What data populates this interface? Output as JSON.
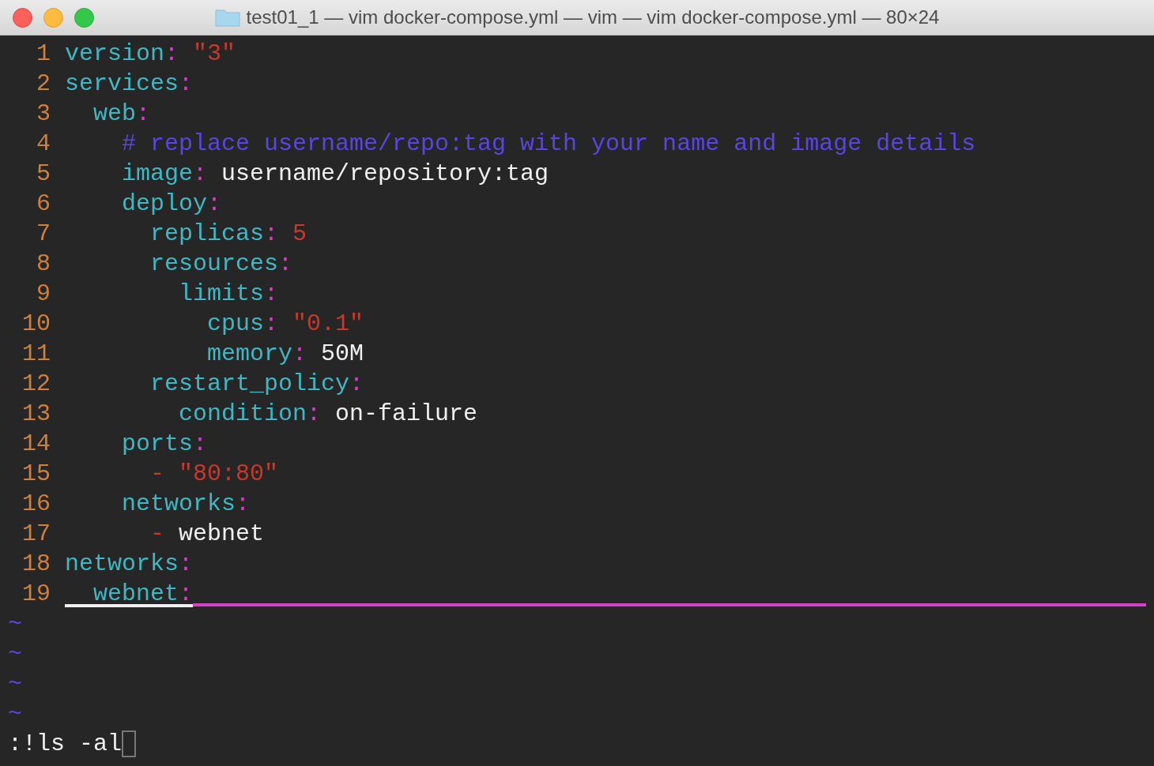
{
  "window": {
    "title": "test01_1 — vim docker-compose.yml — vim — vim docker-compose.yml — 80×24"
  },
  "lines": [
    {
      "number": "1",
      "cursor_line": false,
      "tokens": [
        {
          "kind": "key",
          "text": "version"
        },
        {
          "kind": "colon",
          "text": ":"
        },
        {
          "kind": "string",
          "text": " \"3\""
        }
      ]
    },
    {
      "number": "2",
      "cursor_line": false,
      "tokens": [
        {
          "kind": "key",
          "text": "services"
        },
        {
          "kind": "colon",
          "text": ":"
        }
      ]
    },
    {
      "number": "3",
      "cursor_line": false,
      "tokens": [
        {
          "kind": "key",
          "text": "  web"
        },
        {
          "kind": "colon",
          "text": ":"
        }
      ]
    },
    {
      "number": "4",
      "cursor_line": false,
      "tokens": [
        {
          "kind": "comment",
          "text": "    # replace username/repo:tag with your name and image details"
        }
      ]
    },
    {
      "number": "5",
      "cursor_line": false,
      "tokens": [
        {
          "kind": "key",
          "text": "    image"
        },
        {
          "kind": "colon",
          "text": ":"
        },
        {
          "kind": "plain",
          "text": " username/repository:tag"
        }
      ]
    },
    {
      "number": "6",
      "cursor_line": false,
      "tokens": [
        {
          "kind": "key",
          "text": "    deploy"
        },
        {
          "kind": "colon",
          "text": ":"
        }
      ]
    },
    {
      "number": "7",
      "cursor_line": false,
      "tokens": [
        {
          "kind": "key",
          "text": "      replicas"
        },
        {
          "kind": "colon",
          "text": ":"
        },
        {
          "kind": "string",
          "text": " 5"
        }
      ]
    },
    {
      "number": "8",
      "cursor_line": false,
      "tokens": [
        {
          "kind": "key",
          "text": "      resources"
        },
        {
          "kind": "colon",
          "text": ":"
        }
      ]
    },
    {
      "number": "9",
      "cursor_line": false,
      "tokens": [
        {
          "kind": "key",
          "text": "        limits"
        },
        {
          "kind": "colon",
          "text": ":"
        }
      ]
    },
    {
      "number": "10",
      "cursor_line": false,
      "tokens": [
        {
          "kind": "key",
          "text": "          cpus"
        },
        {
          "kind": "colon",
          "text": ":"
        },
        {
          "kind": "string",
          "text": " \"0.1\""
        }
      ]
    },
    {
      "number": "11",
      "cursor_line": false,
      "tokens": [
        {
          "kind": "key",
          "text": "          memory"
        },
        {
          "kind": "colon",
          "text": ":"
        },
        {
          "kind": "plain",
          "text": " 50M"
        }
      ]
    },
    {
      "number": "12",
      "cursor_line": false,
      "tokens": [
        {
          "kind": "key",
          "text": "      restart_policy"
        },
        {
          "kind": "colon",
          "text": ":"
        }
      ]
    },
    {
      "number": "13",
      "cursor_line": false,
      "tokens": [
        {
          "kind": "key",
          "text": "        condition"
        },
        {
          "kind": "colon",
          "text": ":"
        },
        {
          "kind": "plain",
          "text": " on-failure"
        }
      ]
    },
    {
      "number": "14",
      "cursor_line": false,
      "tokens": [
        {
          "kind": "key",
          "text": "    ports"
        },
        {
          "kind": "colon",
          "text": ":"
        }
      ]
    },
    {
      "number": "15",
      "cursor_line": false,
      "tokens": [
        {
          "kind": "string",
          "text": "      - \"80:80\""
        }
      ]
    },
    {
      "number": "16",
      "cursor_line": false,
      "tokens": [
        {
          "kind": "key",
          "text": "    networks"
        },
        {
          "kind": "colon",
          "text": ":"
        }
      ]
    },
    {
      "number": "17",
      "cursor_line": false,
      "tokens": [
        {
          "kind": "string",
          "text": "      -"
        },
        {
          "kind": "plain",
          "text": " webnet"
        }
      ]
    },
    {
      "number": "18",
      "cursor_line": false,
      "tokens": [
        {
          "kind": "key",
          "text": "networks"
        },
        {
          "kind": "colon",
          "text": ":"
        }
      ]
    },
    {
      "number": "19",
      "cursor_line": true,
      "tokens": [
        {
          "kind": "key",
          "text": "  webnet"
        },
        {
          "kind": "colon",
          "text": ":"
        }
      ]
    }
  ],
  "empty_lines": [
    "~",
    "~",
    "~",
    "~"
  ],
  "command_line": ":!ls -al"
}
